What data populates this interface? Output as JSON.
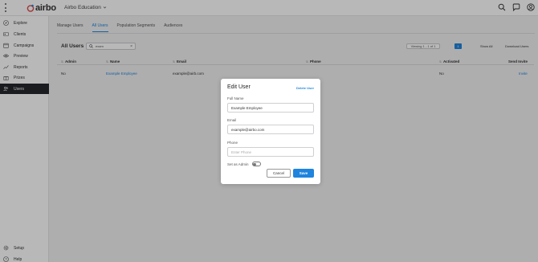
{
  "app": {
    "logo_text": "airbo",
    "org_name": "Airbo Education",
    "brand_color": "#1f84dd",
    "icons": [
      "menu-kebab-icon",
      "search-icon",
      "chat-icon",
      "account-icon"
    ]
  },
  "sidebar": {
    "items": [
      {
        "label": "Explore",
        "icon": "compass-icon"
      },
      {
        "label": "Clients",
        "icon": "clients-icon"
      },
      {
        "label": "Campaigns",
        "icon": "calendar-icon"
      },
      {
        "label": "Preview",
        "icon": "eye-icon"
      },
      {
        "label": "Reports",
        "icon": "chart-icon"
      },
      {
        "label": "Prizes",
        "icon": "gift-icon"
      },
      {
        "label": "Users",
        "icon": "users-icon",
        "active": true
      }
    ],
    "bottom": [
      {
        "label": "Setup",
        "icon": "gear-icon"
      },
      {
        "label": "Help",
        "icon": "help-icon"
      }
    ]
  },
  "tabs": [
    {
      "label": "Manage Users"
    },
    {
      "label": "All Users",
      "active": true
    },
    {
      "label": "Population Segments"
    },
    {
      "label": "Audiences"
    }
  ],
  "users": {
    "title": "All Users",
    "search_value": "exam",
    "viewing": "Viewing 1 - 1 of 1",
    "page": "1",
    "show_all": "Show All",
    "download": "Download Users",
    "columns": [
      "Admin",
      "Name",
      "Email",
      "Phone",
      "Activated",
      "Send Invite"
    ],
    "rows": [
      {
        "admin": "No",
        "name": "Example Employee",
        "email": "example@airb.com",
        "phone": "",
        "activated": "No",
        "invite": "Invite"
      }
    ]
  },
  "modal": {
    "title": "Edit User",
    "delete_label": "Delete User",
    "full_name_label": "Full Name",
    "full_name_value": "Example Employee",
    "email_label": "Email",
    "email_value": "example@airbo.com",
    "phone_label": "Phone",
    "phone_placeholder": "Enter Phone",
    "admin_label": "Set as Admin",
    "admin_on": false,
    "cancel_label": "Cancel",
    "save_label": "Save"
  }
}
